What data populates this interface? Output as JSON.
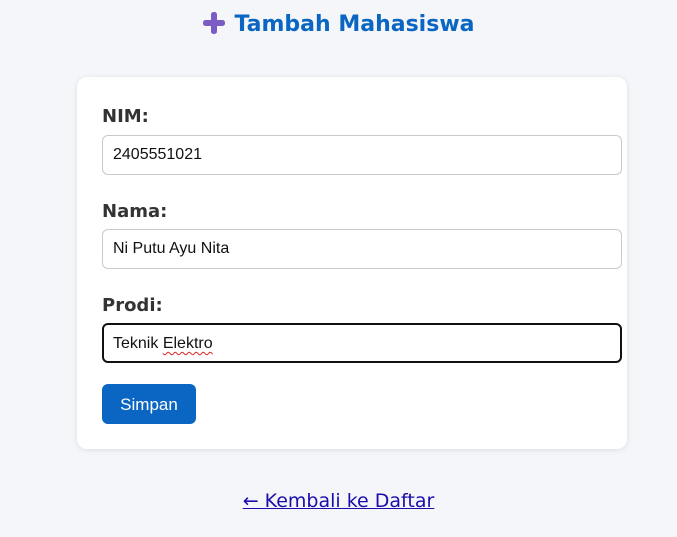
{
  "header": {
    "icon": "plus-icon",
    "title": "Tambah Mahasiswa",
    "accent_color": "#0a66c2",
    "icon_color": "#7b5cc4"
  },
  "form": {
    "nim": {
      "label": "NIM:",
      "value": "2405551021"
    },
    "nama": {
      "label": "Nama:",
      "value": "Ni Putu Ayu Nita"
    },
    "prodi": {
      "label": "Prodi:",
      "value_word1": "Teknik",
      "value_word2": "Elektro"
    },
    "submit_label": "Simpan"
  },
  "footer": {
    "back_link": "← Kembali ke Daftar"
  }
}
